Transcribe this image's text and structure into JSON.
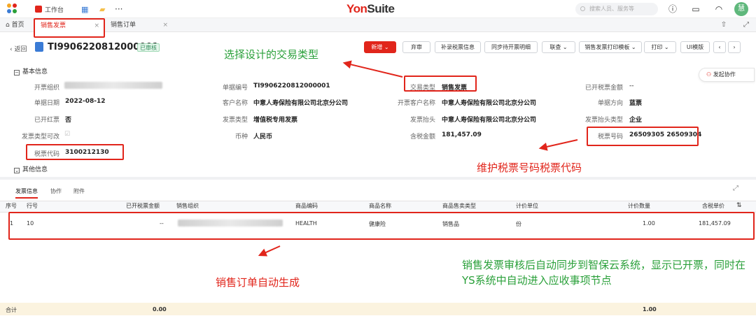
{
  "topbar": {
    "workspace_label": "工作台",
    "brand_a": "Yon",
    "brand_b": "Suite",
    "search_placeholder": "搜索人员、服务等",
    "avatar_text": "慧"
  },
  "tabs": [
    {
      "label": "首页"
    },
    {
      "label": "销售发票"
    },
    {
      "label": "销售订单"
    }
  ],
  "header": {
    "back_label": "返回",
    "doc_number": "TI9906220812000001",
    "status_badge": "已审核"
  },
  "toolbar": {
    "new_label": "新增",
    "abandon_label": "弃审",
    "tax_info_label": "补录税票信息",
    "sync_label": "同步待开票明细",
    "query_label": "联查",
    "print_template_label": "销售发票打印模板",
    "print_label": "打印",
    "ui_template_label": "UI模版"
  },
  "basic_info": {
    "section_title": "基本信息",
    "collab_label": "发起协作",
    "fields": {
      "org_label": "开票组织",
      "doc_no_label": "单据编号",
      "doc_no_value": "TI9906220812000001",
      "trans_type_label": "交易类型",
      "trans_type_value": "销售发票",
      "invoiced_amount_label": "已开税票金额",
      "invoiced_amount_value": "--",
      "date_label": "单据日期",
      "date_value": "2022-08-12",
      "customer_label": "客户名称",
      "customer_value": "中意人寿保险有限公司北京分公司",
      "invoice_customer_label": "开票客户名称",
      "invoice_customer_value": "中意人寿保险有限公司北京分公司",
      "direction_label": "单据方向",
      "direction_value": "蓝票",
      "red_label": "已开红票",
      "red_value": "否",
      "invoice_type_label": "发票类型",
      "invoice_type_value": "增值税专用发票",
      "invoice_head_label": "发票抬头",
      "invoice_head_value": "中意人寿保险有限公司北京分公司",
      "head_type_label": "发票抬头类型",
      "head_type_value": "企业",
      "type_editable_label": "发票类型可改",
      "currency_label": "币种",
      "currency_value": "人民币",
      "total_label": "含税金额",
      "total_value": "181,457.09",
      "tax_no_label": "税票号码",
      "tax_no_value": "26509305 26509304",
      "tax_code_label": "税票代码",
      "tax_code_value": "3100212130"
    },
    "other_section_title": "其他信息"
  },
  "detail": {
    "subtabs": [
      "发票信息",
      "协作",
      "附件"
    ],
    "columns": [
      "序号",
      "行号",
      "已开税票金额",
      "销售组织",
      "商品编码",
      "商品名称",
      "商品售卖类型",
      "计价单位",
      "计价数量",
      "含税单价"
    ],
    "rows": [
      {
        "seq": "1",
        "line": "10",
        "invoiced": "--",
        "code": "HEALTH",
        "name": "健康险",
        "sale_type": "销售品",
        "unit": "份",
        "qty": "1.00",
        "price": "181,457.09"
      }
    ],
    "footer": {
      "label": "合计",
      "invoiced_total": "0.00",
      "qty_total": "1.00"
    }
  },
  "annotations": {
    "choose_type": "选择设计的交易类型",
    "maintain_tax": "维护税票号码税票代码",
    "auto_order": "销售订单自动生成",
    "sync_note": "销售发票审核后自动同步到智保云系统，显示已开票，同时在YS系统中自动进入应收事项节点"
  },
  "colors": {
    "accent": "#e1251b",
    "annotation_green": "#2aa03a"
  }
}
